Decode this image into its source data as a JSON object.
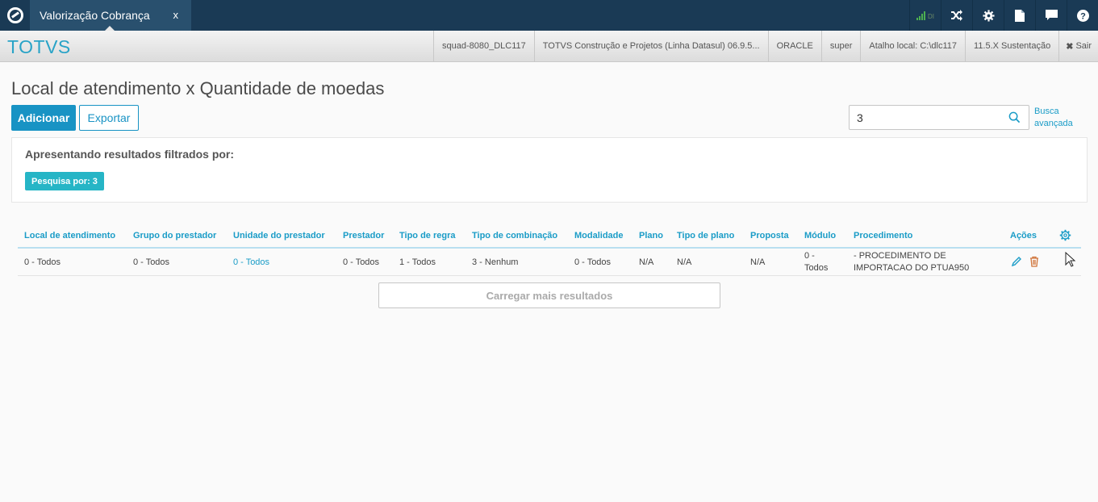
{
  "topbar": {
    "tab_title": "Valorização Cobrança",
    "tab_close": "x",
    "signal_label": "DI",
    "icons": [
      "signal-icon",
      "shuffle-icon",
      "gear-icon",
      "document-icon",
      "chat-icon",
      "help-icon"
    ],
    "help_glyph": "?",
    "colors": {
      "bar": "#1a3a55",
      "tab": "#29506e"
    }
  },
  "subbar": {
    "brand": "TOTVS",
    "items": [
      "squad-8080_DLC117",
      "TOTVS Construção e Projetos (Linha Datasul) 06.9.5...",
      "ORACLE",
      "super",
      "Atalho local: C:\\dlc117",
      "11.5.X Sustentação"
    ],
    "exit_icon": "✖",
    "exit_label": "Sair"
  },
  "main": {
    "title": "Local de atendimento x Quantidade de moedas",
    "add_label": "Adicionar",
    "export_label": "Exportar",
    "search_value": "3",
    "advanced_search": "Busca avançada",
    "filter_title": "Apresentando resultados filtrados por:",
    "filter_badge": "Pesquisa por: 3",
    "load_more": "Carregar mais resultados",
    "accent": "#1893c4"
  },
  "table": {
    "headers": [
      "Local de atendimento",
      "Grupo do prestador",
      "Unidade do prestador",
      "Prestador",
      "Tipo de regra",
      "Tipo de combinação",
      "Modalidade",
      "Plano",
      "Tipo de plano",
      "Proposta",
      "Módulo",
      "Procedimento",
      "Ações"
    ],
    "rows": [
      {
        "local": "0 - Todos",
        "grupo": "0 - Todos",
        "unidade": "0 - Todos",
        "prestador": "0 - Todos",
        "tipo_regra": "1 - Todos",
        "tipo_combinacao": "3 - Nenhum",
        "modalidade": "0 - Todos",
        "plano": "N/A",
        "tipo_plano": "N/A",
        "proposta": "N/A",
        "modulo": "0 - Todos",
        "procedimento": "- PROCEDIMENTO DE IMPORTACAO DO PTUA950"
      }
    ]
  }
}
